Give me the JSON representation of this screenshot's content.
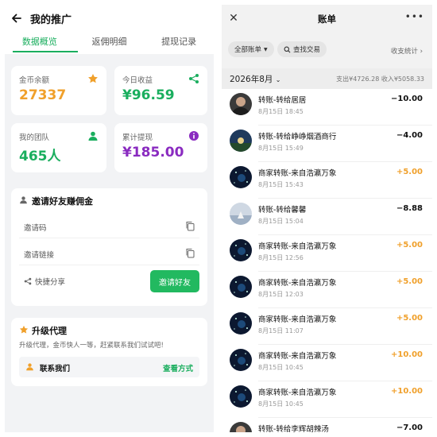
{
  "left": {
    "title": "我的推广",
    "tabs": [
      "数据概览",
      "返佣明细",
      "提现记录"
    ],
    "stats": [
      {
        "label": "金币余额",
        "value": "27337",
        "color": "#f0a02b",
        "icon": "star-icon"
      },
      {
        "label": "今日收益",
        "value": "¥96.59",
        "color": "#1aae5e",
        "icon": "share-icon"
      },
      {
        "label": "我的团队",
        "value": "465人",
        "color": "#1aae5e",
        "icon": "user-icon"
      },
      {
        "label": "累计提现",
        "value": "¥185.00",
        "color": "#8a2bc0",
        "icon": "info-icon"
      }
    ],
    "invite": {
      "title": "邀请好友赚佣金",
      "code_label": "邀请码",
      "link_label": "邀请链接",
      "share_label": "快捷分享",
      "button": "邀请好友"
    },
    "upgrade": {
      "title": "升级代理",
      "desc": "升级代理，金币快人一等，赶紧联系我们试试吧!",
      "contact_label": "联系我们",
      "contact_link": "查看方式"
    }
  },
  "right": {
    "title": "账单",
    "filter_all": "全部账单",
    "filter_search": "查找交易",
    "stats_link": "收支统计 ›",
    "month": "2026年8月",
    "summary": "支出¥4726.28  收入¥5058.33",
    "transactions": [
      {
        "title": "转账-转给居居",
        "time": "8月15日 18:45",
        "amount": "−10.00",
        "type": "out",
        "avatar": "photo-dark"
      },
      {
        "title": "转账-转给峥峥烟酒商行",
        "time": "8月15日 15:49",
        "amount": "−4.00",
        "type": "out",
        "avatar": "photo-night"
      },
      {
        "title": "商家转账-来自浩瀛万象",
        "time": "8月15日 15:43",
        "amount": "+5.00",
        "type": "in",
        "avatar": "space"
      },
      {
        "title": "转账-转给馨馨",
        "time": "8月15日 15:04",
        "amount": "−8.88",
        "type": "out",
        "avatar": "photo-light"
      },
      {
        "title": "商家转账-来自浩瀛万象",
        "time": "8月15日 12:56",
        "amount": "+5.00",
        "type": "in",
        "avatar": "space"
      },
      {
        "title": "商家转账-来自浩瀛万象",
        "time": "8月15日 12:03",
        "amount": "+5.00",
        "type": "in",
        "avatar": "space"
      },
      {
        "title": "商家转账-来自浩瀛万象",
        "time": "8月15日 11:07",
        "amount": "+5.00",
        "type": "in",
        "avatar": "space"
      },
      {
        "title": "商家转账-来自浩瀛万象",
        "time": "8月15日 10:45",
        "amount": "+10.00",
        "type": "in",
        "avatar": "space"
      },
      {
        "title": "商家转账-来自浩瀛万象",
        "time": "8月15日 10:45",
        "amount": "+10.00",
        "type": "in",
        "avatar": "space"
      },
      {
        "title": "转账-转给李辉胡辣汤",
        "time": "",
        "amount": "−7.00",
        "type": "out",
        "avatar": "photo-dark"
      }
    ],
    "colors": {
      "in": "#f0a02b",
      "out": "#111111"
    }
  }
}
